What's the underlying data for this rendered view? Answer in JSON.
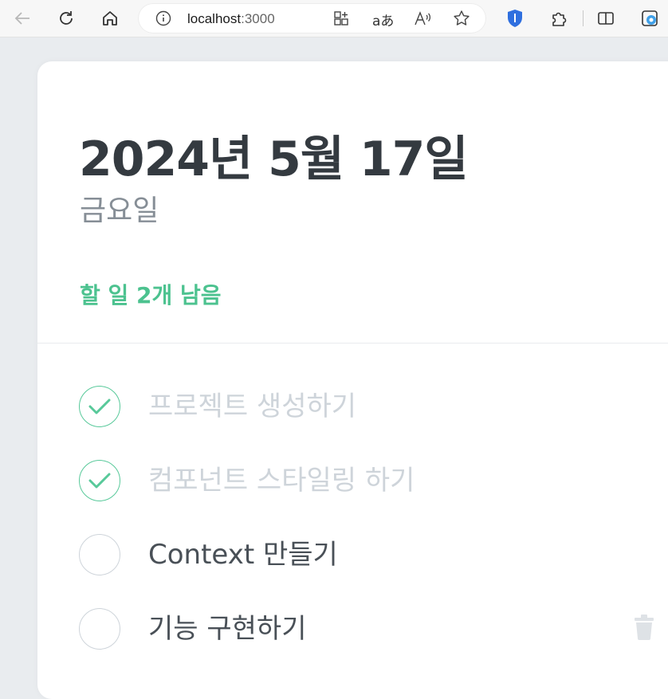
{
  "browser": {
    "url_host": "localhost",
    "url_port": ":3000"
  },
  "header": {
    "date": "2024년 5월 17일",
    "day": "금요일",
    "tasks_left": "할 일 2개 남음"
  },
  "todos": [
    {
      "text": "프로젝트 생성하기",
      "done": true
    },
    {
      "text": "컴포넌트 스타일링 하기",
      "done": true
    },
    {
      "text": "Context 만들기",
      "done": false
    },
    {
      "text": "기능 구현하기",
      "done": false
    }
  ],
  "colors": {
    "accent": "#4cc28f",
    "done_text": "#ced4da",
    "text": "#495057"
  }
}
